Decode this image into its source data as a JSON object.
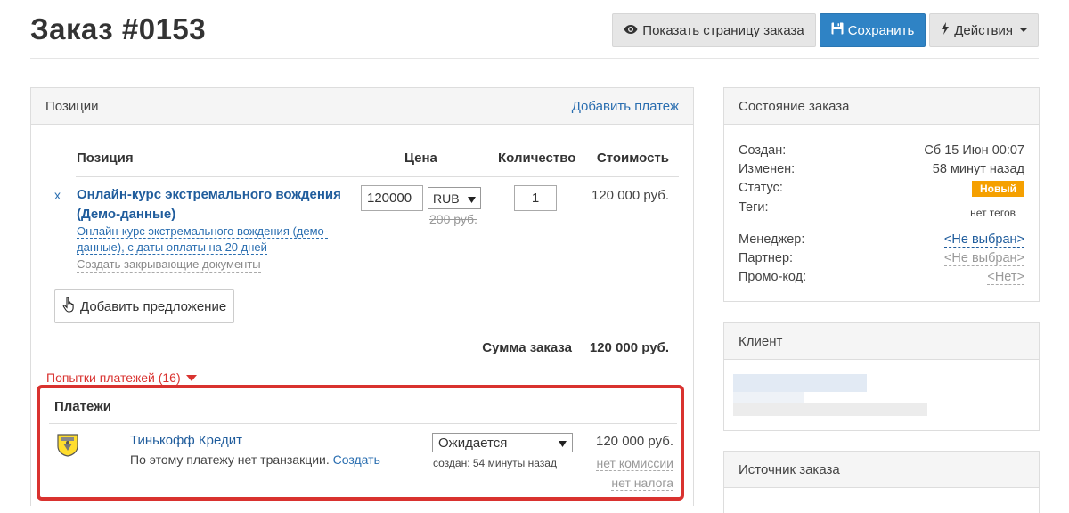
{
  "header": {
    "title": "Заказ #0153",
    "show_page_label": "Показать страницу заказа",
    "save_label": "Сохранить",
    "actions_label": "Действия"
  },
  "positions": {
    "heading": "Позиции",
    "add_payment_link": "Добавить платеж",
    "columns": {
      "item": "Позиция",
      "price": "Цена",
      "qty": "Количество",
      "cost": "Стоимость"
    },
    "item": {
      "remove": "x",
      "name": "Онлайн-курс экстремального вождения (Демо-данные)",
      "desc": "Онлайн-курс экстремального вождения (демо-данные), с даты оплаты на 20 дней",
      "docs_link": "Создать закрывающие документы",
      "price": "120000",
      "currency": "RUB",
      "old_price": "200 руб.",
      "qty": "1",
      "cost": "120 000 руб."
    },
    "add_offer_label": "Добавить предложение",
    "sum_label": "Сумма заказа",
    "sum_value": "120 000 руб.",
    "attempts_label": "Попытки платежей (16)"
  },
  "payments": {
    "title": "Платежи",
    "row": {
      "name": "Тинькофф Кредит",
      "note": "По этому платежу нет транзакции.",
      "create_link": "Создать",
      "status": "Ожидается",
      "created": "создан: 54 минуты назад",
      "amount": "120 000 руб.",
      "fee": "нет комиссии",
      "tax": "нет налога"
    }
  },
  "order_state": {
    "heading": "Состояние заказа",
    "created_label": "Создан:",
    "created_value": "Сб 15 Июн 00:07",
    "modified_label": "Изменен:",
    "modified_value": "58 минут назад",
    "status_label": "Статус:",
    "status_value": "Новый",
    "tags_label": "Теги:",
    "tags_value": "нет тегов",
    "manager_label": "Менеджер:",
    "manager_value": "<Не выбран>",
    "partner_label": "Партнер:",
    "partner_value": "<Не выбран>",
    "promo_label": "Промо-код:",
    "promo_value": "<Нет>"
  },
  "client": {
    "heading": "Клиент"
  },
  "source": {
    "heading": "Источник заказа"
  },
  "colors": {
    "primary": "#2f83c5",
    "danger": "#d9322f",
    "badge": "#f5a000",
    "link": "#1f5c9c"
  }
}
